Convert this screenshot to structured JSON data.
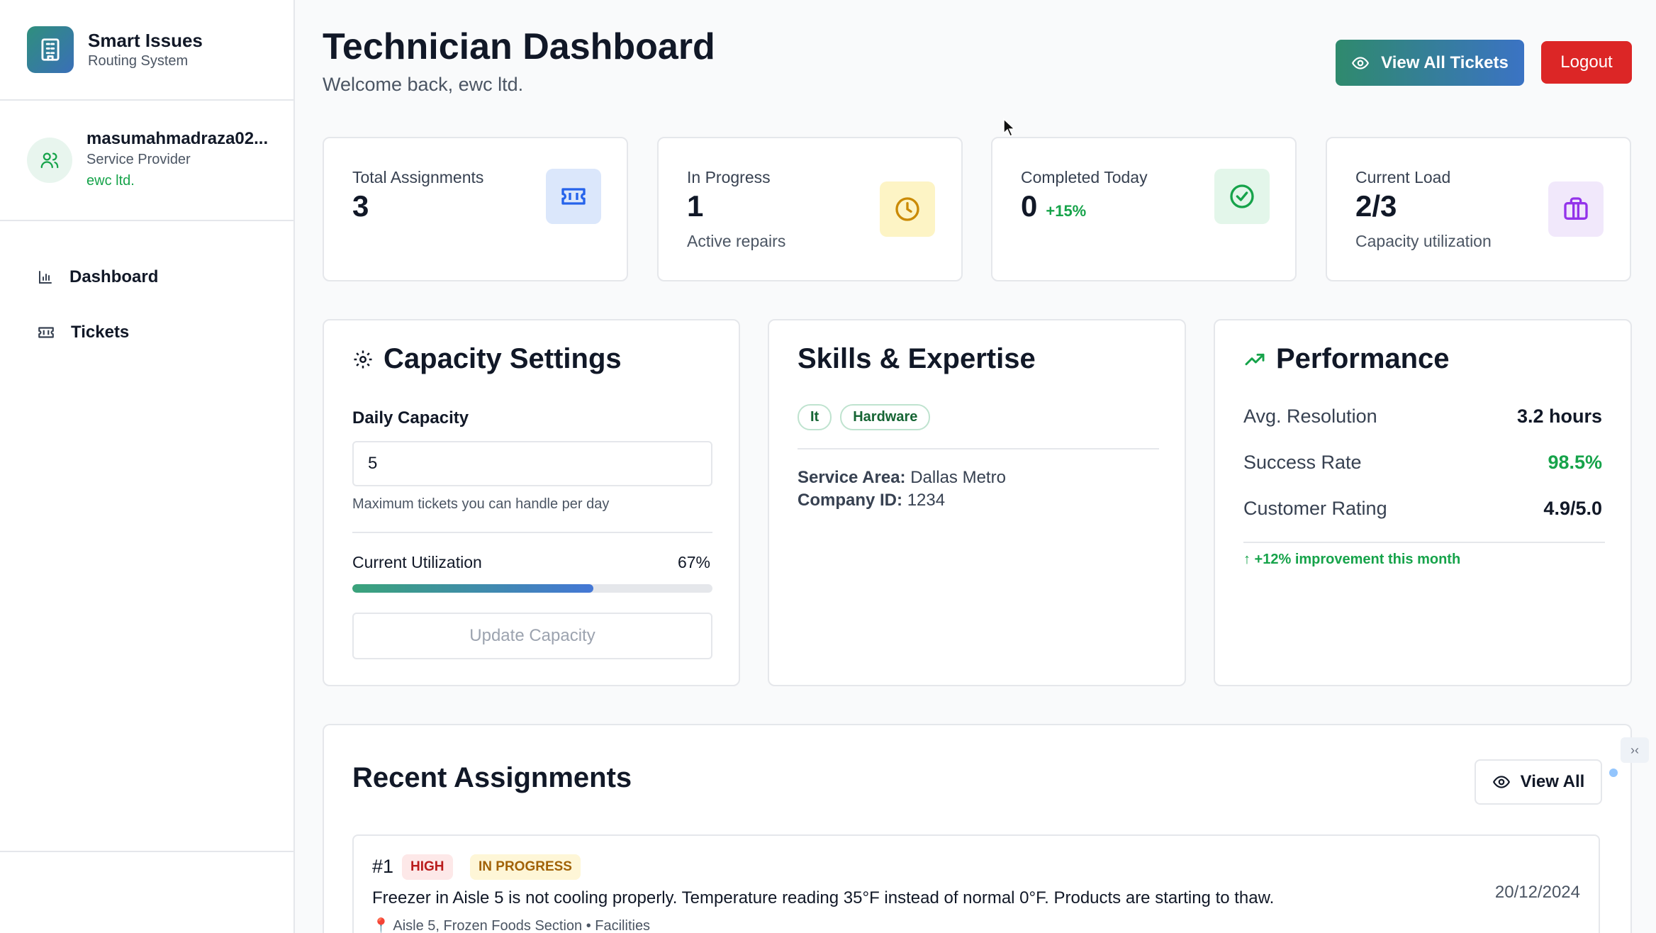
{
  "brand": {
    "title": "Smart Issues",
    "subtitle": "Routing System"
  },
  "user": {
    "name": "masumahmadraza02...",
    "role": "Service Provider",
    "org": "ewc ltd."
  },
  "nav": [
    {
      "label": "Dashboard",
      "icon": "bar-chart-icon"
    },
    {
      "label": "Tickets",
      "icon": "ticket-icon"
    }
  ],
  "header": {
    "title": "Technician Dashboard",
    "subtitle": "Welcome back, ewc ltd.",
    "view_all_label": "View All Tickets",
    "logout_label": "Logout"
  },
  "stats": {
    "total": {
      "label": "Total Assignments",
      "value": "3",
      "icon": "ticket-icon",
      "color": "#dbe7fb"
    },
    "in_progress": {
      "label": "In Progress",
      "value": "1",
      "sub": "Active repairs",
      "icon": "clock-icon",
      "color": "#fdf4c5"
    },
    "completed": {
      "label": "Completed Today",
      "value": "0",
      "trend": "+15%",
      "icon": "check-circle-icon",
      "color": "#e3f6ea"
    },
    "load": {
      "label": "Current Load",
      "value": "2/3",
      "sub": "Capacity utilization",
      "icon": "briefcase-icon",
      "color": "#f1e8fb"
    }
  },
  "capacity": {
    "title": "Capacity Settings",
    "field_label": "Daily Capacity",
    "field_value": "5",
    "hint": "Maximum tickets you can handle per day",
    "util_label": "Current Utilization",
    "util_value": "67%",
    "util_fraction": 0.67,
    "button_label": "Update Capacity"
  },
  "skills": {
    "title": "Skills & Expertise",
    "tags": [
      "It",
      "Hardware"
    ],
    "service_area_label": "Service Area:",
    "service_area": "Dallas Metro",
    "company_id_label": "Company ID:",
    "company_id": "1234"
  },
  "performance": {
    "title": "Performance",
    "rows": [
      {
        "k": "Avg. Resolution",
        "v": "3.2 hours"
      },
      {
        "k": "Success Rate",
        "v": "98.5%"
      },
      {
        "k": "Customer Rating",
        "v": "4.9/5.0"
      }
    ],
    "note": "↑ +12% improvement this month"
  },
  "recent": {
    "title": "Recent Assignments",
    "view_all_label": "View All",
    "tickets": [
      {
        "id": "#1",
        "priority": "HIGH",
        "status": "IN PROGRESS",
        "description": "Freezer in Aisle 5 is not cooling properly. Temperature reading 35°F instead of normal 0°F. Products are starting to thaw.",
        "location": "📍 Aisle 5, Frozen Foods Section • Facilities",
        "date": "20/12/2024"
      }
    ]
  },
  "colors": {
    "accent_green": "#16a34a",
    "danger": "#dc2626",
    "gradient_start": "#2f8a6d",
    "gradient_end": "#3b73c4"
  }
}
